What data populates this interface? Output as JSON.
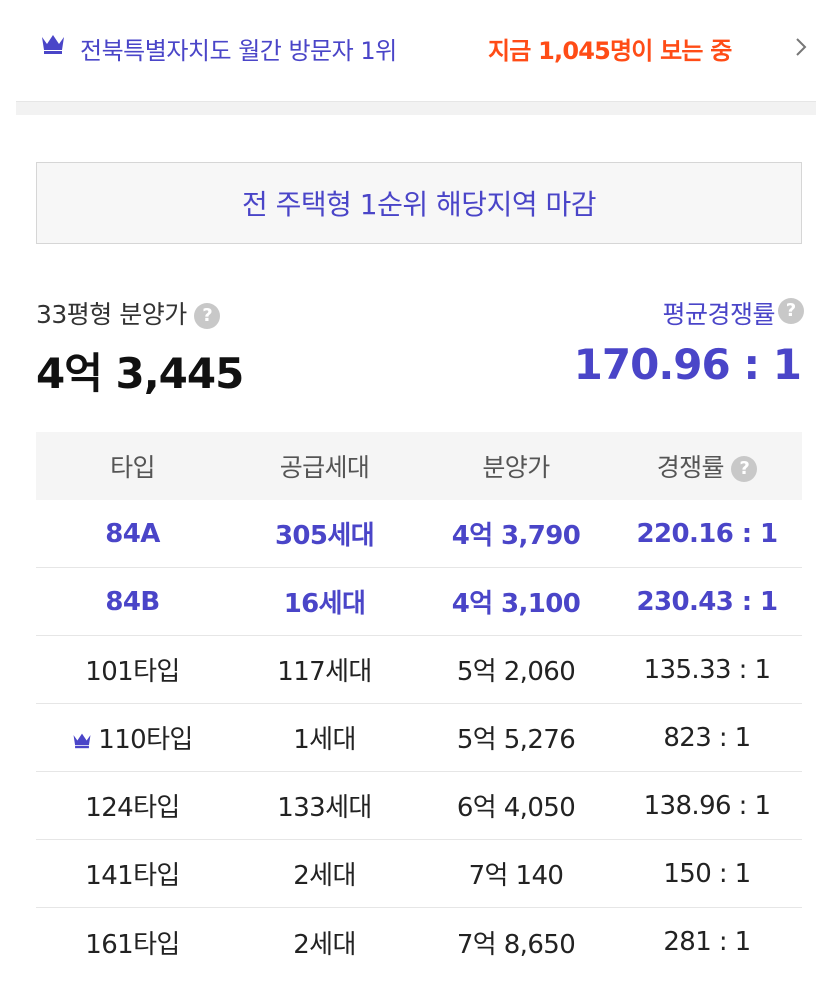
{
  "banner": {
    "rank_text": "전북특별자치도 월간 방문자 1위",
    "viewers_text": "지금 1,045명이 보는 중"
  },
  "notice": "전 주택형 1순위 해당지역 마감",
  "summary": {
    "price_label": "33평형 분양가",
    "price_value": "4억 3,445",
    "competition_label": "평균경쟁률",
    "competition_value": "170.96 : 1"
  },
  "table": {
    "headers": [
      "타입",
      "공급세대",
      "분양가",
      "경쟁률"
    ],
    "rows": [
      {
        "type": "84A",
        "units": "305세대",
        "price": "4억 3,790",
        "ratio": "220.16 : 1",
        "highlight": true
      },
      {
        "type": "84B",
        "units": "16세대",
        "price": "4억 3,100",
        "ratio": "230.43 : 1",
        "highlight": true
      },
      {
        "type": "101타입",
        "units": "117세대",
        "price": "5억 2,060",
        "ratio": "135.33 : 1",
        "highlight": false
      },
      {
        "type": "110타입",
        "units": "1세대",
        "price": "5억 5,276",
        "ratio": "823 : 1",
        "highlight": false,
        "crown": true
      },
      {
        "type": "124타입",
        "units": "133세대",
        "price": "6억 4,050",
        "ratio": "138.96 : 1",
        "highlight": false
      },
      {
        "type": "141타입",
        "units": "2세대",
        "price": "7억 140",
        "ratio": "150 : 1",
        "highlight": false
      },
      {
        "type": "161타입",
        "units": "2세대",
        "price": "7억 8,650",
        "ratio": "281 : 1",
        "highlight": false
      }
    ]
  },
  "help_glyph": "?",
  "colors": {
    "accent": "#4a45c8",
    "hot": "#ff4c16"
  },
  "icons": {
    "crown": "crown-icon",
    "help": "help-circle-icon",
    "chevron": "chevron-right-icon"
  }
}
